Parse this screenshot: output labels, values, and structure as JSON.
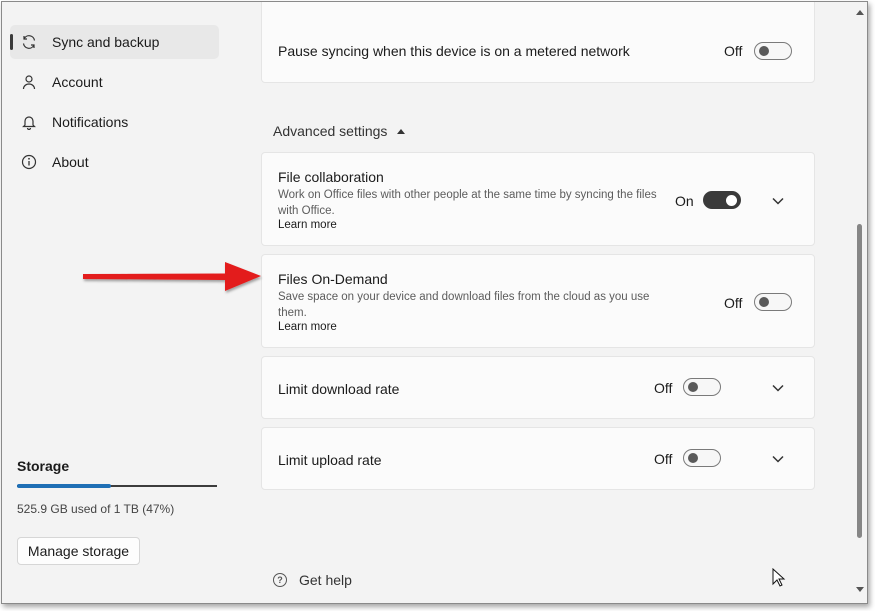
{
  "sidebar": {
    "items": [
      {
        "label": "Sync and backup",
        "icon": "sync-icon",
        "active": true
      },
      {
        "label": "Account",
        "icon": "person-icon"
      },
      {
        "label": "Notifications",
        "icon": "bell-icon"
      },
      {
        "label": "About",
        "icon": "info-icon"
      }
    ],
    "storage": {
      "title": "Storage",
      "usage_text": "525.9 GB used of 1 TB (47%)",
      "used_fraction": 0.47,
      "manage_label": "Manage storage"
    }
  },
  "metered": {
    "title": "Pause syncing when this device is on a metered network",
    "state": "Off"
  },
  "advanced": {
    "header": "Advanced settings",
    "collaboration": {
      "title": "File collaboration",
      "description": "Work on Office files with other people at the same time by syncing the files with Office.",
      "link": "Learn more",
      "state": "On"
    },
    "on_demand": {
      "title": "Files On-Demand",
      "description": "Save space on your device and download files from the cloud as you use them.",
      "link": "Learn more",
      "state": "Off"
    },
    "download": {
      "title": "Limit download rate",
      "state": "Off"
    },
    "upload": {
      "title": "Limit upload rate",
      "state": "Off"
    }
  },
  "help": {
    "label": "Get help"
  },
  "colors": {
    "accent": "#1f6fb5",
    "annotation_arrow": "#e31b1b"
  }
}
